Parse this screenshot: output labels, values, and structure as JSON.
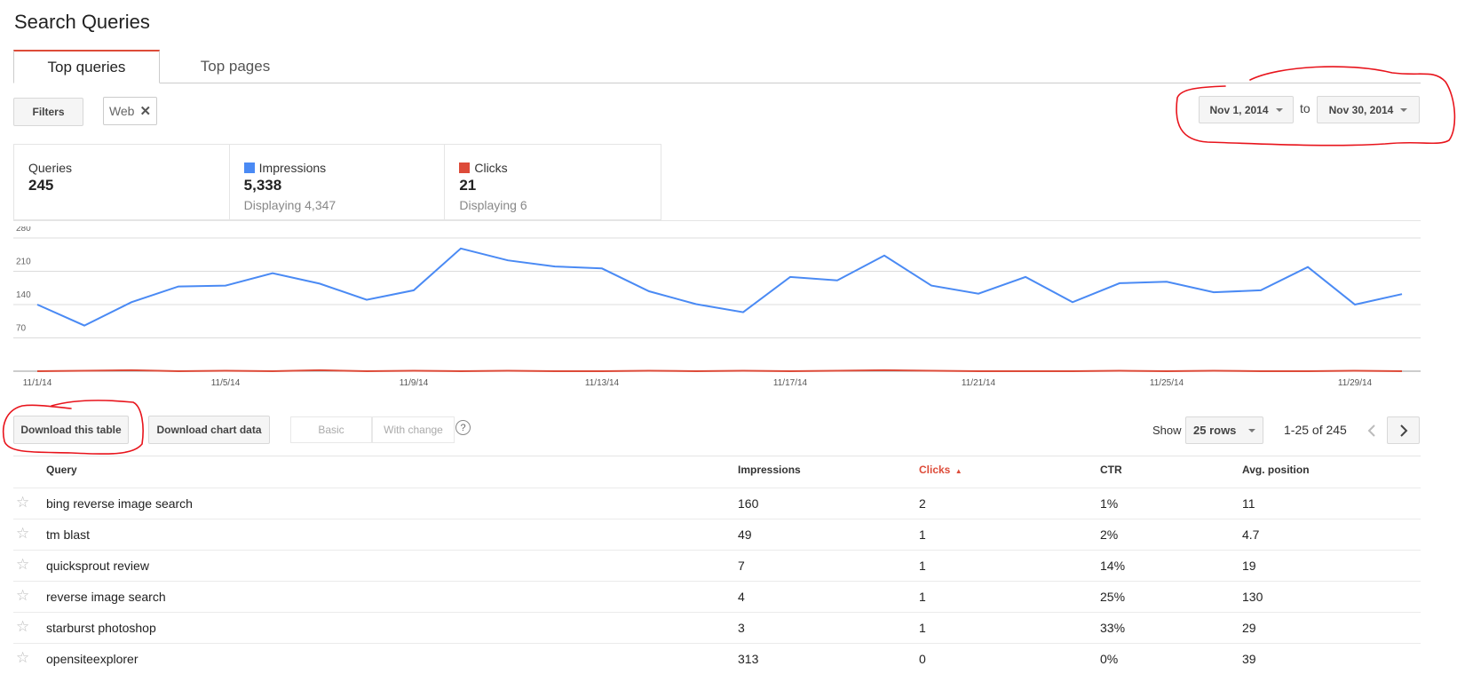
{
  "page": {
    "title": "Search Queries"
  },
  "tabs": [
    {
      "label": "Top queries",
      "active": true
    },
    {
      "label": "Top pages",
      "active": false
    }
  ],
  "filters": {
    "button_label": "Filters",
    "chip_label": "Web"
  },
  "date_range": {
    "start": "Nov 1, 2014",
    "separator": "to",
    "end": "Nov 30, 2014"
  },
  "summary": {
    "queries": {
      "label": "Queries",
      "value": "245"
    },
    "impressions": {
      "label": "Impressions",
      "value": "5,338",
      "sub": "Displaying 4,347",
      "color": "#4a8af4"
    },
    "clicks": {
      "label": "Clicks",
      "value": "21",
      "sub": "Displaying 6",
      "color": "#dd4b39"
    }
  },
  "chart_data": {
    "type": "line",
    "x": [
      "11/1",
      "11/2",
      "11/3",
      "11/4",
      "11/5",
      "11/6",
      "11/7",
      "11/8",
      "11/9",
      "11/10",
      "11/11",
      "11/12",
      "11/13",
      "11/14",
      "11/15",
      "11/16",
      "11/17",
      "11/18",
      "11/19",
      "11/20",
      "11/21",
      "11/22",
      "11/23",
      "11/24",
      "11/25",
      "11/26",
      "11/27",
      "11/28",
      "11/29",
      "11/30"
    ],
    "x_tick_labels": [
      "11/1/14",
      "11/5/14",
      "11/9/14",
      "11/13/14",
      "11/17/14",
      "11/21/14",
      "11/25/14",
      "11/29/14"
    ],
    "y_ticks": [
      "70",
      "140",
      "210",
      "280"
    ],
    "ylim": [
      0,
      280
    ],
    "grid": true,
    "series": [
      {
        "name": "Impressions",
        "color": "#4a8af4",
        "values": [
          140,
          96,
          145,
          178,
          180,
          206,
          184,
          150,
          170,
          258,
          233,
          220,
          216,
          168,
          141,
          124,
          198,
          191,
          243,
          180,
          163,
          198,
          145,
          185,
          188,
          166,
          170,
          219,
          140,
          162
        ]
      },
      {
        "name": "Clicks",
        "color": "#dd4b39",
        "values": [
          0,
          1,
          2,
          0,
          1,
          0,
          2,
          0,
          1,
          0,
          1,
          0,
          0,
          1,
          0,
          1,
          0,
          1,
          2,
          1,
          0,
          0,
          0,
          1,
          0,
          1,
          0,
          0,
          1,
          0
        ]
      }
    ]
  },
  "table_controls": {
    "download_table": "Download this table",
    "download_chart": "Download chart data",
    "view_basic": "Basic",
    "view_change": "With change",
    "help": "?",
    "show_label": "Show",
    "rows_select": "25 rows",
    "pagination": "1-25 of 245",
    "prev_icon": "chevron-left-icon",
    "next_icon": "chevron-right-icon"
  },
  "table": {
    "headers": [
      "Query",
      "Impressions",
      "Clicks",
      "CTR",
      "Avg. position"
    ],
    "sort_indicator": "▲",
    "rows": [
      [
        "bing reverse image search",
        "160",
        "2",
        "1%",
        "11"
      ],
      [
        "tm blast",
        "49",
        "1",
        "2%",
        "4.7"
      ],
      [
        "quicksprout review",
        "7",
        "1",
        "14%",
        "19"
      ],
      [
        "reverse image search",
        "4",
        "1",
        "25%",
        "130"
      ],
      [
        "starburst photoshop",
        "3",
        "1",
        "33%",
        "29"
      ],
      [
        "opensiteexplorer",
        "313",
        "0",
        "0%",
        "39"
      ]
    ]
  },
  "star_glyph": "☆",
  "annotation_color": "#e8141c"
}
